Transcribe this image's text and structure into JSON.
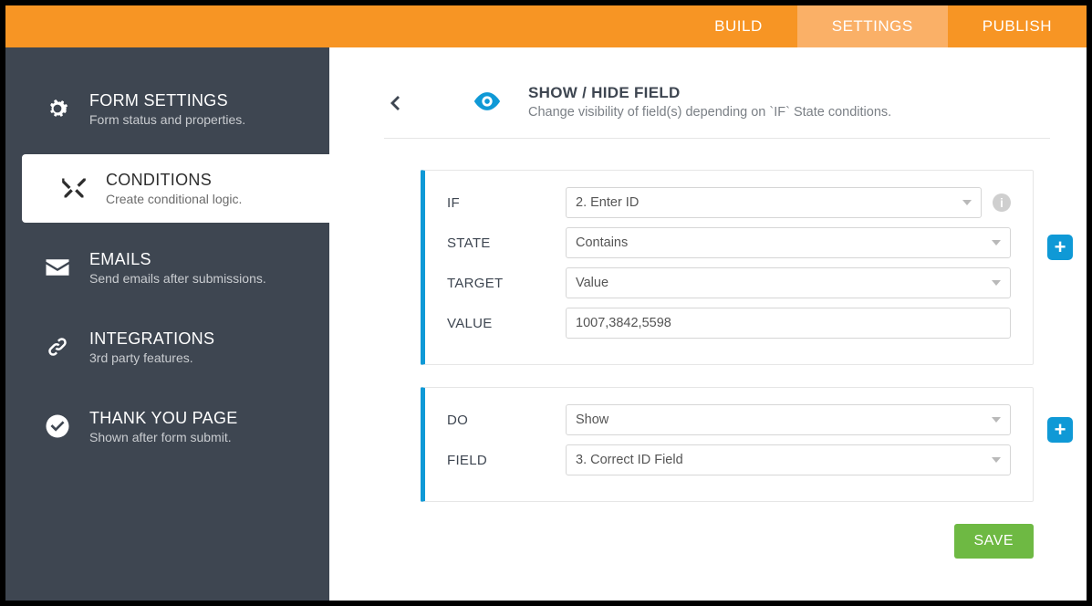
{
  "topbar": {
    "tabs": [
      {
        "label": "BUILD"
      },
      {
        "label": "SETTINGS"
      },
      {
        "label": "PUBLISH"
      }
    ]
  },
  "sidebar": {
    "items": [
      {
        "title": "FORM SETTINGS",
        "sub": "Form status and properties."
      },
      {
        "title": "CONDITIONS",
        "sub": "Create conditional logic."
      },
      {
        "title": "EMAILS",
        "sub": "Send emails after submissions."
      },
      {
        "title": "INTEGRATIONS",
        "sub": "3rd party features."
      },
      {
        "title": "THANK YOU PAGE",
        "sub": "Shown after form submit."
      }
    ]
  },
  "header": {
    "title": "SHOW / HIDE FIELD",
    "sub": "Change visibility of field(s) depending on `IF` State conditions."
  },
  "condition": {
    "if_label": "IF",
    "if_value": "2. Enter ID",
    "state_label": "STATE",
    "state_value": "Contains",
    "target_label": "TARGET",
    "target_value": "Value",
    "value_label": "VALUE",
    "value_value": "1007,3842,5598"
  },
  "action": {
    "do_label": "DO",
    "do_value": "Show",
    "field_label": "FIELD",
    "field_value": "3. Correct ID Field"
  },
  "save_label": "SAVE",
  "info_glyph": "i",
  "plus_glyph": "+"
}
